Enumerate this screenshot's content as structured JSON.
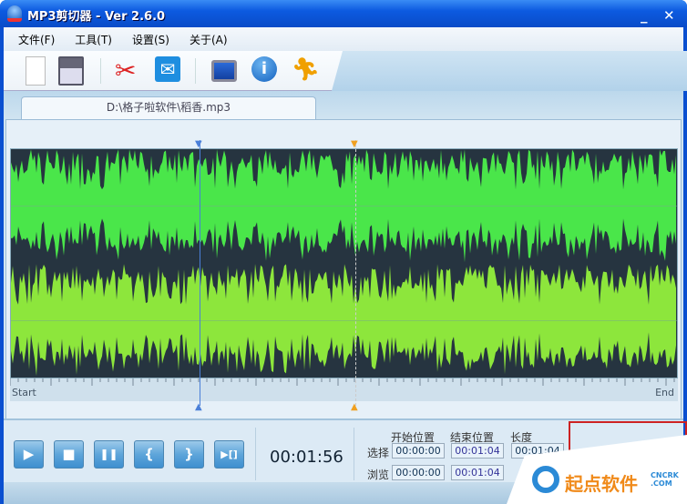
{
  "window": {
    "title": "MP3剪切器 - Ver 2.6.0",
    "minimize": "_",
    "close": "✕"
  },
  "menu": [
    "文件(F)",
    "工具(T)",
    "设置(S)",
    "关于(A)"
  ],
  "toolbar": {
    "icons": [
      "new-icon",
      "save-icon",
      "cut-icon",
      "email-icon",
      "monitor-icon",
      "info-icon",
      "runner-icon"
    ]
  },
  "tab": {
    "label": "D:\\格子啦软件\\稻香.mp3"
  },
  "timeline": {
    "start": "Start",
    "end": "End"
  },
  "colors": {
    "wave_top": "#4ae64a",
    "wave_bottom": "#8de63c",
    "wave_bg": "#263440",
    "start_marker": "#4a7fd8",
    "end_marker": "#f0a020"
  },
  "controls": {
    "buttons": [
      "▶",
      "■",
      "❚❚",
      "{",
      "}",
      "▶[]"
    ],
    "time": "00:01:56"
  },
  "position": {
    "headers": [
      "开始位置",
      "结束位置",
      "长度"
    ],
    "rows": [
      {
        "label": "选择",
        "start": "00:00:00",
        "end": "00:01:04",
        "length": "00:01:04"
      },
      {
        "label": "浏览",
        "start": "00:00:00",
        "end": "00:01:04"
      }
    ]
  },
  "watermark": {
    "text": "起点软件",
    "sub": "CNCRK .COM"
  }
}
